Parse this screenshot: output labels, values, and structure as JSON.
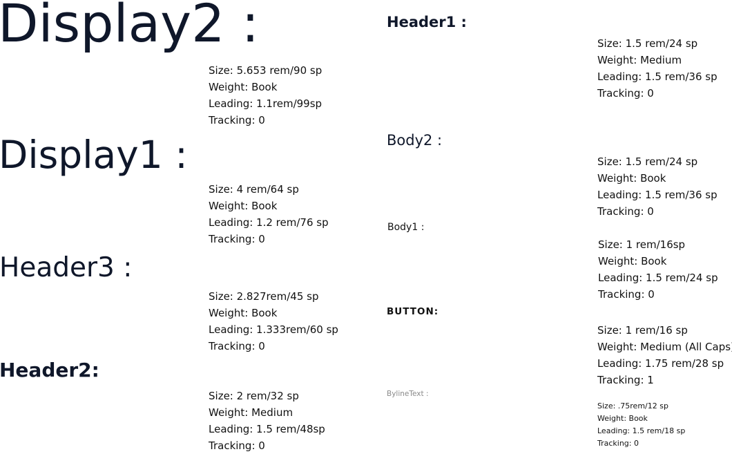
{
  "styles": {
    "display2": {
      "label": "Display2 :",
      "size": "Size: 5.653 rem/90 sp",
      "weight": "Weight: Book",
      "leading": "Leading: 1.1rem/99sp",
      "tracking": "Tracking: 0"
    },
    "display1": {
      "label": "Display1 :",
      "size": "Size: 4 rem/64 sp",
      "weight": "Weight: Book",
      "leading": "Leading: 1.2 rem/76 sp",
      "tracking": "Tracking: 0"
    },
    "header3": {
      "label": "Header3 :",
      "size": "Size: 2.827rem/45 sp",
      "weight": "Weight: Book",
      "leading": "Leading: 1.333rem/60 sp",
      "tracking": "Tracking: 0"
    },
    "header2": {
      "label": "Header2:",
      "size": "Size: 2 rem/32 sp",
      "weight": "Weight: Medium",
      "leading": "Leading: 1.5 rem/48sp",
      "tracking": "Tracking: 0"
    },
    "header1": {
      "label": "Header1 :",
      "size": "Size: 1.5 rem/24 sp",
      "weight": "Weight: Medium",
      "leading": "Leading: 1.5 rem/36 sp",
      "tracking": "Tracking: 0"
    },
    "body2": {
      "label": "Body2 :",
      "size": "Size: 1.5 rem/24 sp",
      "weight": "Weight: Book",
      "leading": "Leading: 1.5 rem/36 sp",
      "tracking": "Tracking: 0"
    },
    "body1": {
      "label": "Body1 :",
      "size": "Size: 1 rem/16sp",
      "weight": "Weight: Book",
      "leading": "Leading: 1.5 rem/24 sp",
      "tracking": "Tracking: 0"
    },
    "button": {
      "label": "BUTTON:",
      "size": "Size: 1 rem/16 sp",
      "weight": "Weight: Medium (All Caps)",
      "leading": "Leading: 1.75 rem/28 sp",
      "tracking": "Tracking: 1"
    },
    "byline": {
      "label": "BylineText :",
      "size": "Size: .75rem/12 sp",
      "weight": "Weight: Book",
      "leading": "Leading: 1.5 rem/18 sp",
      "tracking": "Tracking: 0"
    }
  },
  "colors": {
    "heading_text": "#0f172a",
    "spec_text": "#111111",
    "byline_text": "#8a8a8a",
    "background": "#ffffff"
  }
}
